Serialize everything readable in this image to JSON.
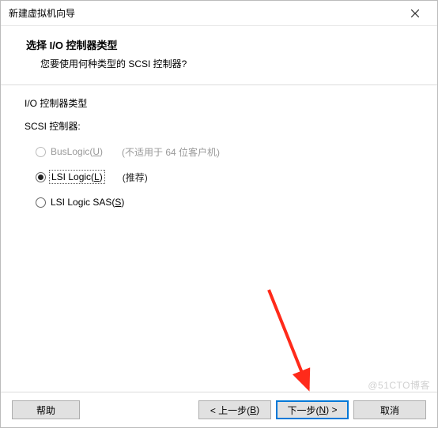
{
  "window": {
    "title": "新建虚拟机向导"
  },
  "header": {
    "heading": "选择 I/O 控制器类型",
    "subheading": "您要使用何种类型的 SCSI 控制器?"
  },
  "content": {
    "group_label": "I/O 控制器类型",
    "subgroup_label": "SCSI 控制器:",
    "options": [
      {
        "label_prefix": "BusLogic(",
        "accel": "U",
        "label_suffix": ")",
        "hint": "(不适用于 64 位客户机)",
        "disabled": true,
        "selected": false
      },
      {
        "label_prefix": "LSI Logic(",
        "accel": "L",
        "label_suffix": ")",
        "hint": "(推荐)",
        "disabled": false,
        "selected": true
      },
      {
        "label_prefix": "LSI Logic SAS(",
        "accel": "S",
        "label_suffix": ")",
        "hint": "",
        "disabled": false,
        "selected": false
      }
    ]
  },
  "footer": {
    "help": "帮助",
    "back_prefix": "< 上一步(",
    "back_accel": "B",
    "back_suffix": ")",
    "next_prefix": "下一步(",
    "next_accel": "N",
    "next_suffix": ") >",
    "cancel": "取消"
  },
  "watermark": "@51CTO博客",
  "annotation": {
    "arrow_color": "#ff2a1a"
  }
}
